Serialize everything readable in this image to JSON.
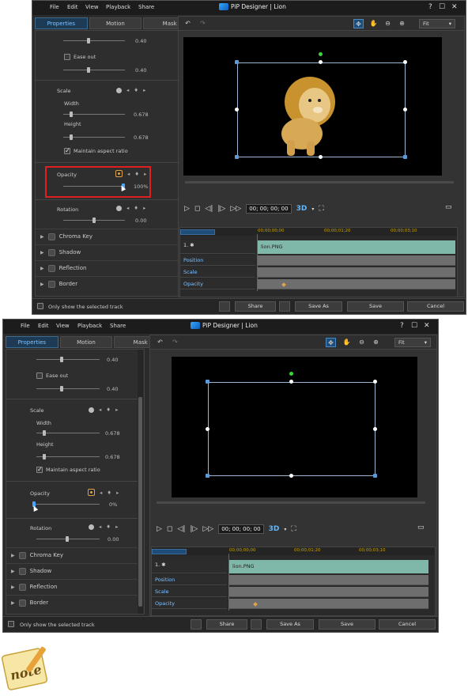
{
  "menu": [
    "File",
    "Edit",
    "View",
    "Playback",
    "Share"
  ],
  "title": "PiP Designer | Lion",
  "window_controls": [
    "?",
    "☐",
    "✕"
  ],
  "tabs": [
    "Properties",
    "Motion",
    "Mask"
  ],
  "props": {
    "fade_value_1": "0.40",
    "ease_out": "Ease out",
    "fade_value_2": "0.40",
    "scale": "Scale",
    "width": "Width",
    "width_value": "0.678",
    "height": "Height",
    "height_value": "0.678",
    "maintain": "Maintain aspect ratio",
    "opacity": "Opacity",
    "rotation": "Rotation",
    "rotation_value": "0.00"
  },
  "screens": [
    {
      "opacity_value": "100%",
      "opacity_level": 1.0
    },
    {
      "opacity_value": "0%",
      "opacity_level": 0.0
    }
  ],
  "groups": [
    "Chroma Key",
    "Shadow",
    "Reflection",
    "Border"
  ],
  "toolbar": {
    "fit": "Fit"
  },
  "timecode": "00; 00; 00; 00",
  "three_d": "3D",
  "ruler": [
    "00;00;00;00",
    "00;00;01;20",
    "00;00;03;10"
  ],
  "tracks": {
    "track_label": "1.",
    "clip": "lion.PNG",
    "rows": [
      "Position",
      "Scale",
      "Opacity"
    ]
  },
  "bottom": {
    "only_selected": "Only show the selected track",
    "share": "Share",
    "save_as": "Save As",
    "save": "Save",
    "cancel": "Cancel"
  },
  "note_label": "note"
}
